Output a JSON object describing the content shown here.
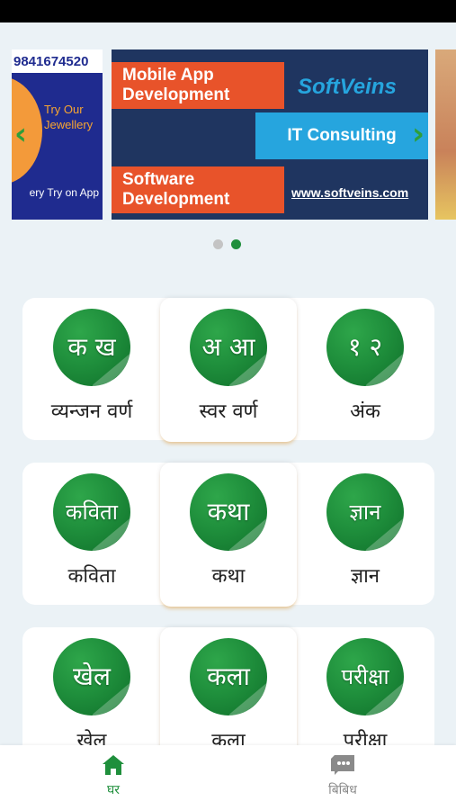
{
  "carousel": {
    "left_banner": {
      "phone": "9841674520",
      "try_our": "Try Our",
      "jewellery": "Jewellery",
      "tagline": "ery Try on App"
    },
    "main_banner": {
      "mobile_app": "Mobile App",
      "development_1": "Development",
      "brand": "SoftVeins",
      "it_consulting": "IT Consulting",
      "software": "Software",
      "development_2": "Development",
      "url": "www.softveins.com"
    },
    "prev_icon": "chevron-left-icon",
    "next_icon": "chevron-right-icon",
    "dots": {
      "count": 2,
      "active_index": 1,
      "active_color": "#1f8f3c",
      "inactive_color": "#c4c4c4"
    }
  },
  "categories": [
    {
      "glyph": "क ख",
      "label": "व्यन्जन वर्ण",
      "raised": false
    },
    {
      "glyph": "अ आ",
      "label": "स्वर वर्ण",
      "raised": true
    },
    {
      "glyph": "१ २",
      "label": "अंक",
      "raised": false
    },
    {
      "glyph": "कविता",
      "label": "कविता",
      "raised": false
    },
    {
      "glyph": "कथा",
      "label": "कथा",
      "raised": true
    },
    {
      "glyph": "ज्ञान",
      "label": "ज्ञान",
      "raised": false
    },
    {
      "glyph": "खेल",
      "label": "खेल",
      "raised": false
    },
    {
      "glyph": "कला",
      "label": "कला",
      "raised": true
    },
    {
      "glyph": "परीक्षा",
      "label": "परीक्षा",
      "raised": false
    }
  ],
  "bottom_nav": {
    "home": {
      "label": "घर",
      "icon": "home-icon",
      "active": true
    },
    "misc": {
      "label": "बिबिध",
      "icon": "chat-bubble-icon",
      "active": false
    }
  },
  "colors": {
    "accent_green": "#1f8f3c",
    "nav_inactive": "#8a8a8a",
    "background": "#ebf2f6"
  }
}
